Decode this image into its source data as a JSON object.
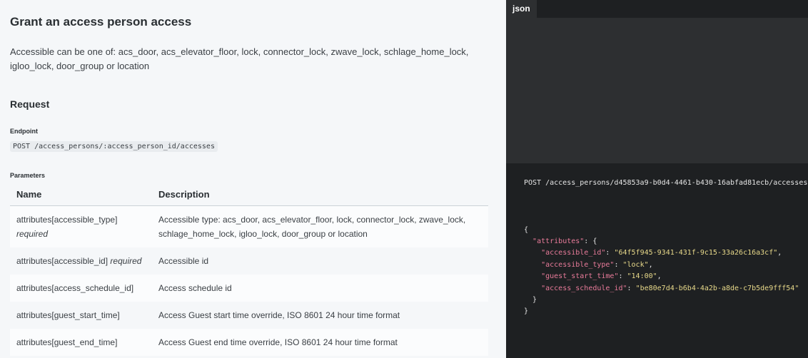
{
  "doc": {
    "title": "Grant an access person access",
    "description": "Accessible can be one of: acs_door, acs_elevator_floor, lock, connector_lock, zwave_lock, schlage_home_lock, igloo_lock, door_group or location",
    "request_heading": "Request",
    "endpoint_label": "Endpoint",
    "endpoint": "POST /access_persons/:access_person_id/accesses",
    "parameters_label": "Parameters",
    "table": {
      "headers": {
        "name": "Name",
        "description": "Description"
      },
      "rows": [
        {
          "name": "attributes[accessible_type]",
          "required": "required",
          "description": "Accessible type: acs_door, acs_elevator_floor, lock, connector_lock, zwave_lock, schlage_home_lock, igloo_lock, door_group or location"
        },
        {
          "name": "attributes[accessible_id]",
          "required": "required",
          "description": "Accessible id"
        },
        {
          "name": "attributes[access_schedule_id]",
          "required": "",
          "description": "Access schedule id"
        },
        {
          "name": "attributes[guest_start_time]",
          "required": "",
          "description": "Access Guest start time override, ISO 8601 24 hour time format"
        },
        {
          "name": "attributes[guest_end_time]",
          "required": "",
          "description": "Access Guest end time override, ISO 8601 24 hour time format"
        }
      ]
    }
  },
  "example": {
    "tab": "json",
    "request_line": "POST /access_persons/d45853a9-b0d4-4461-b430-16abfad81ecb/accesses",
    "body": {
      "open": "{",
      "attributes_key": "\"attributes\"",
      "attributes_open": ": {",
      "fields": [
        {
          "key": "\"accessible_id\"",
          "value": "\"64f5f945-9341-431f-9c15-33a26c16a3cf\"",
          "sep": ","
        },
        {
          "key": "\"accessible_type\"",
          "value": "\"lock\"",
          "sep": ","
        },
        {
          "key": "\"guest_start_time\"",
          "value": "\"14:00\"",
          "sep": ","
        },
        {
          "key": "\"access_schedule_id\"",
          "value": "\"be80e7d4-b6b4-4a2b-a8de-c7b5de9fff54\"",
          "sep": ""
        }
      ],
      "attributes_close": "}",
      "close": "}"
    }
  },
  "colors": {
    "code_key": "#e97b9a",
    "code_string": "#e8d98a",
    "panel_bg": "#2d2f31",
    "code_bg": "#1e2022"
  }
}
